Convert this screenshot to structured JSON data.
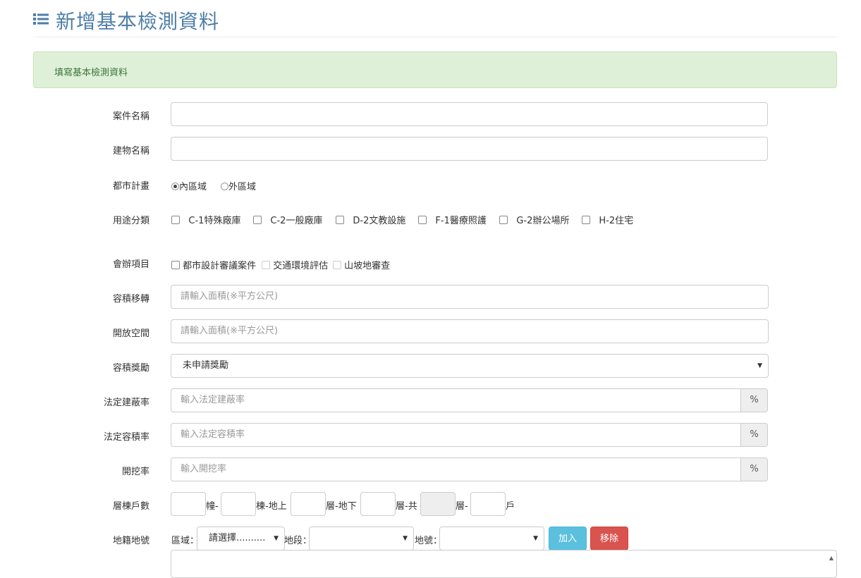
{
  "header": {
    "title": "新增基本檢測資料"
  },
  "alert": {
    "text": "填寫基本檢測資料"
  },
  "fields": {
    "case_name": {
      "label": "案件名稱",
      "value": ""
    },
    "building_name": {
      "label": "建物名稱",
      "value": ""
    },
    "urban_plan": {
      "label": "都市計畫",
      "options": [
        "內區域",
        "外區域"
      ],
      "selected": "內區域"
    },
    "use_category": {
      "label": "用途分類",
      "options": [
        "C-1特殊廠庫",
        "C-2一般廠庫",
        "D-2文教設施",
        "F-1醫療照護",
        "G-2辦公場所",
        "H-2住宅"
      ]
    },
    "review_items": {
      "label": "會辦項目",
      "options": [
        "都市設計審議案件",
        "交通環境評估",
        "山坡地審查"
      ]
    },
    "far_transfer": {
      "label": "容積移轉",
      "placeholder": "請輸入面積(※平方公尺)"
    },
    "open_space": {
      "label": "開放空間",
      "placeholder": "請輸入面積(※平方公尺)"
    },
    "far_bonus": {
      "label": "容積獎勵",
      "selected": "未申請獎勵"
    },
    "legal_coverage": {
      "label": "法定建蔽率",
      "placeholder": "輸入法定建蔽率",
      "unit": "%"
    },
    "legal_far": {
      "label": "法定容積率",
      "placeholder": "輸入法定容積率",
      "unit": "%"
    },
    "excavation": {
      "label": "開挖率",
      "placeholder": "輸入開挖率",
      "unit": "%"
    },
    "floors": {
      "label": "層棟戶數",
      "sep1": "幢-",
      "sep2": "棟-地上",
      "sep3": "層-地下",
      "sep4": "層-共",
      "sep5": "層-",
      "sep6": "戶"
    },
    "land": {
      "label": "地籍地號",
      "district_label": "區域：",
      "district_value": "請選擇..........",
      "section_label": "地段：",
      "section_value": "",
      "number_label": "地號：",
      "number_value": "",
      "add_button": "加入",
      "remove_button": "移除"
    }
  },
  "colors": {
    "title": "#4d7ea8",
    "alert_bg": "#dff0d8",
    "alert_text": "#3c763d",
    "btn_info": "#5bc0de",
    "btn_danger": "#d9534f"
  },
  "icons": {
    "header": "list-icon",
    "select": "caret-down-icon"
  }
}
